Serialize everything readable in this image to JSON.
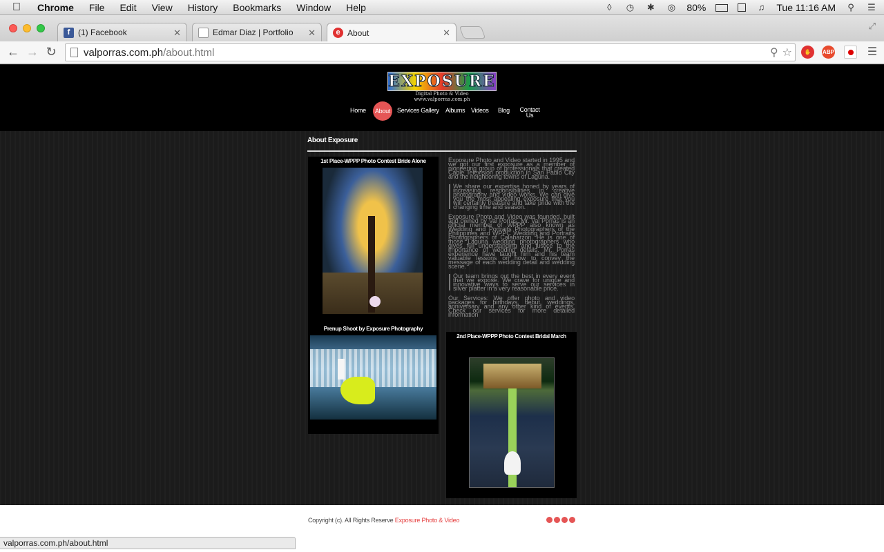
{
  "menubar": {
    "app": "Chrome",
    "items": [
      "File",
      "Edit",
      "View",
      "History",
      "Bookmarks",
      "Window",
      "Help"
    ],
    "battery": "80%",
    "clock": "Tue 11:16 AM"
  },
  "tabs": [
    {
      "title": "(1) Facebook",
      "icon": "facebook-icon",
      "color": "#3b5998"
    },
    {
      "title": "Edmar Diaz | Portfolio",
      "icon": "page-icon",
      "color": "#ffffff"
    },
    {
      "title": "About",
      "icon": "exposure-icon",
      "color": "#e03131",
      "active": true
    }
  ],
  "address": {
    "host": "valporras.com.ph",
    "path": "/about.html"
  },
  "extensions": [
    {
      "name": "stop-extension-icon",
      "label": "",
      "color": "#e03131"
    },
    {
      "name": "adblock-plus-icon",
      "label": "ABP",
      "color": "#e84a2d"
    },
    {
      "name": "flag-extension-icon",
      "label": "",
      "color": "#ffffff"
    }
  ],
  "site": {
    "logo_text": "EXPOSURE",
    "logo_sub1": "Digital Photo & Video",
    "logo_sub2": "www.valporras.com.ph",
    "nav": [
      "Home",
      "About",
      "Services Gallery",
      "Albums",
      "Videos",
      "Blog",
      "Contact Us"
    ],
    "nav_active": "About",
    "accent": "#e55555"
  },
  "content": {
    "title": "About Exposure",
    "photo1_caption": "1st Place-WPPP Photo Contest Bride Alone",
    "photo2_caption": "Prenup Shoot by Exposure Photography",
    "photo3_caption": "2nd Place-WPPP Photo Contest Bridal March",
    "para1": "Exposure Photo and Video started in 1995 and we got our first exposure as a member of pioneering group of professionals that created Cable Television production in San Pablo City and the neighboring towns of Laguna.",
    "quote1": "We share our expertise honed by years of increasing responsibilities in creative photography and video works. We can give you the most appealing exposure that you will certainly treasure and take pride with the changing time and season.",
    "para2": "Exposure Photo and Video was founded, built and owned by Val Porras. Mr. Val Porras is an official member of WPPP also known as Wedding and Portraits Photographers of the Philippines and WPPC Wedding and Portraits Photographers of Calabarzon. He is one of those Laguna wedding photographers who gives full understanding and justice to the importance of wedding details. Mr. Porras experience have taught him and his team valuable lessons on how to convey the message of each wedding detail and wedding scene.",
    "quote2": "Our team brings out the best in every event that we expose. We crave for unique and innovative ways to serve our services in silver platter in a very reasonable price.",
    "para3": "Our Services: We offer photo and video packages for birthdays, debut, weddings, anniversary and any other kind of events. Check our services for more detailed information"
  },
  "footer": {
    "copy": "Copyright (c). All Rights Reserve",
    "brand": "Exposure Photo & Video"
  },
  "status_url": "valporras.com.ph/about.html"
}
